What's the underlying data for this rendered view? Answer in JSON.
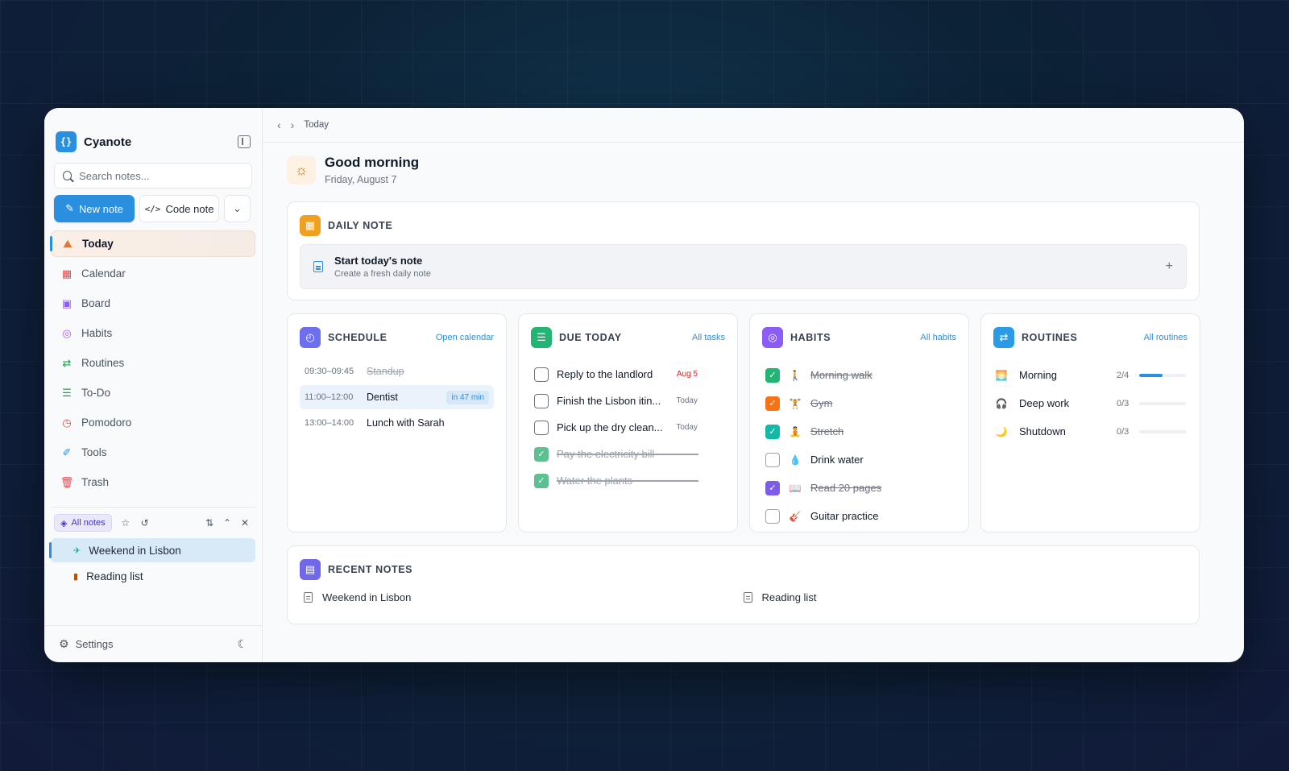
{
  "app": {
    "name": "Cyanote",
    "logo_glyph": "{}"
  },
  "sidebar": {
    "search_placeholder": "Search notes...",
    "new_note_label": "New note",
    "code_note_label": "Code note",
    "nav": [
      {
        "label": "Today",
        "icon": "sunrise-icon",
        "active": true
      },
      {
        "label": "Calendar",
        "icon": "calendar-icon"
      },
      {
        "label": "Board",
        "icon": "board-icon"
      },
      {
        "label": "Habits",
        "icon": "target-icon"
      },
      {
        "label": "Routines",
        "icon": "repeat-icon"
      },
      {
        "label": "To-Do",
        "icon": "checklist-icon"
      },
      {
        "label": "Pomodoro",
        "icon": "timer-icon"
      },
      {
        "label": "Tools",
        "icon": "wrench-icon"
      },
      {
        "label": "Trash",
        "icon": "trash-icon"
      }
    ],
    "notes_filter_label": "All notes",
    "notes": [
      {
        "title": "Weekend in Lisbon",
        "icon": "airplane-icon",
        "active": true
      },
      {
        "title": "Reading list",
        "icon": "books-icon"
      }
    ],
    "settings_label": "Settings"
  },
  "topbar": {
    "breadcrumb": "Today"
  },
  "greeting": {
    "title": "Good morning",
    "date": "Friday, August 7"
  },
  "daily_note": {
    "heading": "DAILY NOTE",
    "cta_title": "Start today's note",
    "cta_subtitle": "Create a fresh daily note"
  },
  "schedule": {
    "heading": "SCHEDULE",
    "link": "Open calendar",
    "events": [
      {
        "time": "09:30–09:45",
        "title": "Standup",
        "done": true
      },
      {
        "time": "11:00–12:00",
        "title": "Dentist",
        "badge": "in 47 min",
        "current": true
      },
      {
        "time": "13:00–14:00",
        "title": "Lunch with Sarah"
      }
    ]
  },
  "due_today": {
    "heading": "DUE TODAY",
    "link": "All tasks",
    "tasks": [
      {
        "title": "Reply to the landlord",
        "due": "Aug 5",
        "overdue": true,
        "checked": false
      },
      {
        "title": "Finish the Lisbon itin...",
        "due": "Today",
        "checked": false
      },
      {
        "title": "Pick up the dry clean...",
        "due": "Today",
        "checked": false
      },
      {
        "title": "Pay the electricity bill",
        "checked": true
      },
      {
        "title": "Water the plants",
        "checked": true
      }
    ]
  },
  "habits": {
    "heading": "HABITS",
    "link": "All habits",
    "items": [
      {
        "name": "Morning walk",
        "emoji": "🚶",
        "checked": true,
        "color": "#22b573"
      },
      {
        "name": "Gym",
        "emoji": "🏋",
        "checked": true,
        "color": "#f97316"
      },
      {
        "name": "Stretch",
        "emoji": "🧘",
        "checked": true,
        "color": "#14b8a6"
      },
      {
        "name": "Drink water",
        "emoji": "💧",
        "checked": false
      },
      {
        "name": "Read 20 pages",
        "emoji": "📖",
        "checked": true,
        "color": "#7c5ce8"
      },
      {
        "name": "Guitar practice",
        "emoji": "🎸",
        "checked": false
      }
    ]
  },
  "routines": {
    "heading": "ROUTINES",
    "link": "All routines",
    "items": [
      {
        "name": "Morning",
        "emoji": "🌅",
        "count": "2/4",
        "progress": 0.5
      },
      {
        "name": "Deep work",
        "emoji": "🎧",
        "count": "0/3",
        "progress": 0
      },
      {
        "name": "Shutdown",
        "emoji": "🌙",
        "count": "0/3",
        "progress": 0
      }
    ]
  },
  "recent_notes": {
    "heading": "RECENT NOTES",
    "items": [
      "Weekend in Lisbon",
      "Reading list"
    ]
  },
  "colors": {
    "accent": "#2b8fe0",
    "daily_icon": "#f0a020",
    "schedule_icon": "#6c6ff0",
    "due_icon": "#22b573",
    "habits_icon": "#8b5cf6",
    "routines_icon": "#2b9be8",
    "recent_icon": "#7068e8"
  }
}
